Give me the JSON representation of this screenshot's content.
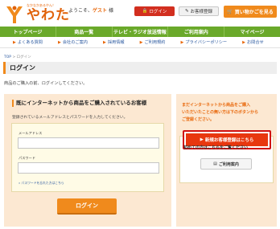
{
  "header": {
    "logo_tagline": "なかなかあるやん！",
    "logo_text": "やわた",
    "welcome_prefix": "ようこそ、",
    "welcome_guest": "ゲスト",
    "welcome_suffix": " 様",
    "login_button": "ログイン",
    "register_button": "お客様登録",
    "cart_button": "買い物かごを見る"
  },
  "nav": {
    "items": [
      {
        "label": "トップページ"
      },
      {
        "label": "商品一覧"
      },
      {
        "label": "テレビ・ラジオ放送情報"
      },
      {
        "label": "ご利用案内"
      },
      {
        "label": "マイページ"
      }
    ]
  },
  "subnav": {
    "items": [
      {
        "label": "よくある質問"
      },
      {
        "label": "会社のご案内"
      },
      {
        "label": "採用情報"
      },
      {
        "label": "ご利用規約"
      },
      {
        "label": "プライバシーポリシー"
      },
      {
        "label": "お問合せ"
      }
    ]
  },
  "breadcrumb": {
    "home": "TOP",
    "separator": " > ",
    "current": "ログイン"
  },
  "page": {
    "title": "ログイン",
    "intro": "商品のご購入の前、ログインしてください。"
  },
  "login_panel": {
    "heading": "既にインターネットから商品をご購入されているお客様",
    "description": "登録されているメールアドレスとパスワードを入力してください。",
    "email_label": "メールアドレス",
    "email_value": "",
    "password_label": "パスワード",
    "password_value": "",
    "forgot_link": "» パスワードを忘れた方はこちら",
    "login_button": "ログイン"
  },
  "register_panel": {
    "message_lines": [
      "まだインターネットから商品をご購入",
      "いただいたことの無い方は下のボタンから",
      "ご登録ください。"
    ],
    "new_register_button": "新規お客様登録はこちら",
    "first_time_text": "初めての方はこちらをご覧ください",
    "guide_button": "ご利用案内"
  },
  "colors": {
    "brand_orange": "#f08a1c",
    "nav_green": "#6aa92a",
    "alert_red": "#d22f1f",
    "panel_peach": "#fce8d2"
  }
}
